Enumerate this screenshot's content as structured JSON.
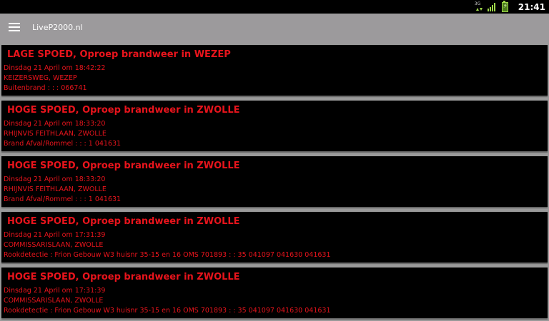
{
  "status_bar": {
    "network_label": "3G",
    "time": "21:41",
    "icons": [
      "3g-data-icon",
      "signal-strength-icon",
      "battery-charging-icon"
    ]
  },
  "action_bar": {
    "title": "LiveP2000.nl",
    "menu_icon": "hamburger-menu-icon"
  },
  "colors": {
    "card_background": "#000000",
    "text_red": "#e8141c",
    "app_background": "#9a9a9a"
  },
  "messages": [
    {
      "title": "LAGE SPOED, Oproep brandweer in WEZEP",
      "datetime": "Dinsdag 21 April om 18:42:22",
      "address": "KEIZERSWEG, WEZEP",
      "details": "Buitenbrand : : : 066741"
    },
    {
      "title": "HOGE SPOED, Oproep brandweer in ZWOLLE",
      "datetime": "Dinsdag 21 April om 18:33:20",
      "address": "RHIJNVIS FEITHLAAN, ZWOLLE",
      "details": "Brand Afval/Rommel : : : 1 041631"
    },
    {
      "title": "HOGE SPOED, Oproep brandweer in ZWOLLE",
      "datetime": "Dinsdag 21 April om 18:33:20",
      "address": "RHIJNVIS FEITHLAAN, ZWOLLE",
      "details": "Brand Afval/Rommel : : : 1 041631"
    },
    {
      "title": "HOGE SPOED, Oproep brandweer in ZWOLLE",
      "datetime": "Dinsdag 21 April om 17:31:39",
      "address": "COMMISSARISLAAN, ZWOLLE",
      "details": "Rookdetectie : Frion Gebouw W3 huisnr 35-15 en 16 OMS 701893 : : 35 041097 041630 041631"
    },
    {
      "title": "HOGE SPOED, Oproep brandweer in ZWOLLE",
      "datetime": "Dinsdag 21 April om 17:31:39",
      "address": "COMMISSARISLAAN, ZWOLLE",
      "details": "Rookdetectie : Frion Gebouw W3 huisnr 35-15 en 16 OMS 701893 : : 35 041097 041630 041631"
    }
  ]
}
